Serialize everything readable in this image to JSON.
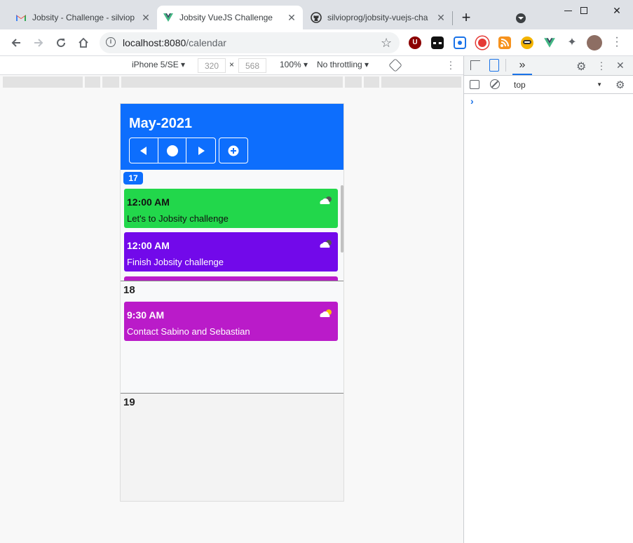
{
  "browser": {
    "tabs": [
      {
        "title": "Jobsity - Challenge - silviop",
        "active": false
      },
      {
        "title": "Jobsity VueJS Challenge",
        "active": true
      },
      {
        "title": "silvioprog/jobsity-vuejs-cha",
        "active": false
      }
    ],
    "url": "localhost:8080/calendar",
    "url_path": "/calendar",
    "url_host": "localhost:8080"
  },
  "device_toolbar": {
    "device": "iPhone 5/SE",
    "width": "320",
    "height": "568",
    "dim_separator": "×",
    "zoom": "100%",
    "throttling": "No throttling"
  },
  "devtools": {
    "context": "top",
    "prompt": "›",
    "more_tabs": "»"
  },
  "calendar": {
    "month_title": "May-2021",
    "days": [
      {
        "number": "17",
        "events": [
          {
            "time": "12:00 AM",
            "description": "Let's to Jobsity challenge",
            "color": "#22d74b",
            "text_color": "#111111",
            "icon": "cloud-night-icon"
          },
          {
            "time": "12:00 AM",
            "description": "Finish Jobsity challenge",
            "color": "#7209ea",
            "text_color": "#ffffff",
            "icon": "cloud-night-icon"
          }
        ]
      },
      {
        "number": "18",
        "events": [
          {
            "time": "9:30 AM",
            "description": "Contact Sabino and Sebastian",
            "color": "#ba1bc9",
            "text_color": "#ffffff",
            "icon": "partly-sunny-icon"
          }
        ]
      },
      {
        "number": "19",
        "events": []
      }
    ]
  },
  "colors": {
    "primary": "#0d6efd"
  }
}
